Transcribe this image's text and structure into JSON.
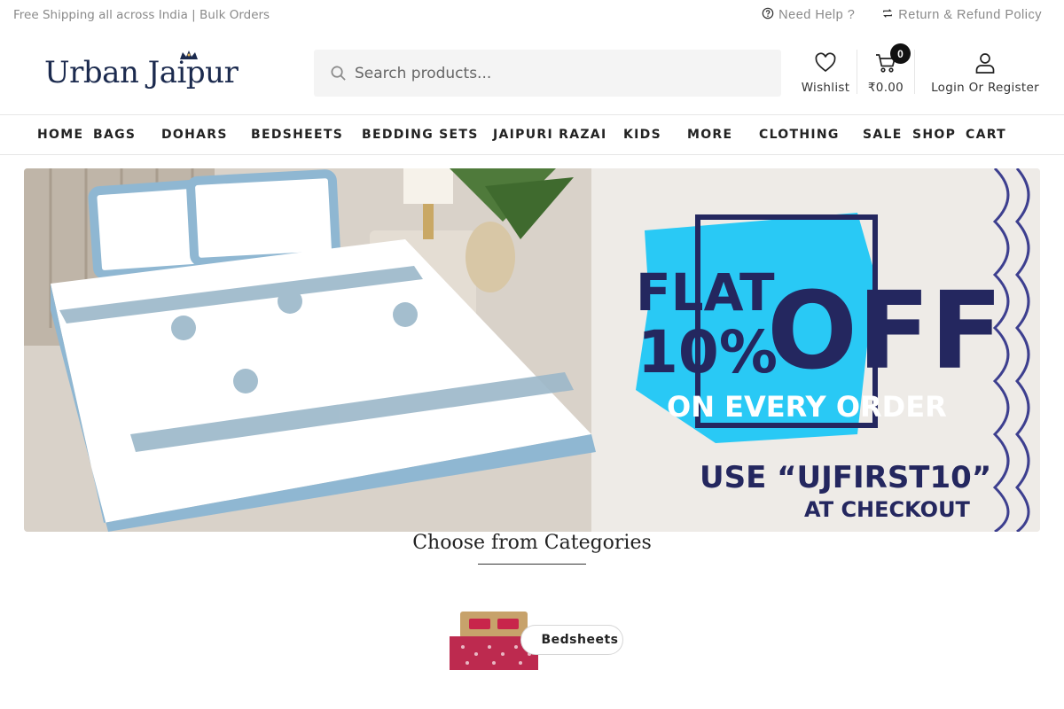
{
  "topbar": {
    "promo_text": "Free Shipping all across India | Bulk Orders",
    "help_label": "Need Help ?",
    "return_label": "Return & Refund Policy"
  },
  "header": {
    "logo_text": "Urban Jaipur",
    "search_placeholder": "Search products...",
    "wishlist_label": "Wishlist",
    "cart_count": "0",
    "cart_total": "₹0.00",
    "account_label": "Login Or Register"
  },
  "nav": {
    "items": [
      "HOME",
      "BAGS",
      "DOHARS",
      "BEDSHEETS",
      "BEDDING SETS",
      "JAIPURI RAZAI",
      "KIDS",
      "MORE",
      "CLOTHING",
      "SALE",
      "SHOP",
      "CART"
    ]
  },
  "banner": {
    "line1": "FLAT",
    "line2": "10%",
    "line3": "OFF",
    "line4": "ON EVERY ORDER",
    "line5": "USE “UJFIRST10”",
    "line6": "AT CHECKOUT",
    "colors": {
      "navy": "#24275f",
      "cyan": "#29c9f5",
      "blue_border": "#7aa9cc"
    }
  },
  "categories": {
    "heading": "Choose from Categories",
    "items": [
      {
        "label": "Bedsheets"
      }
    ]
  },
  "icons": [
    "help-icon",
    "refresh-icon",
    "search-icon",
    "heart-icon",
    "cart-icon",
    "user-icon"
  ]
}
